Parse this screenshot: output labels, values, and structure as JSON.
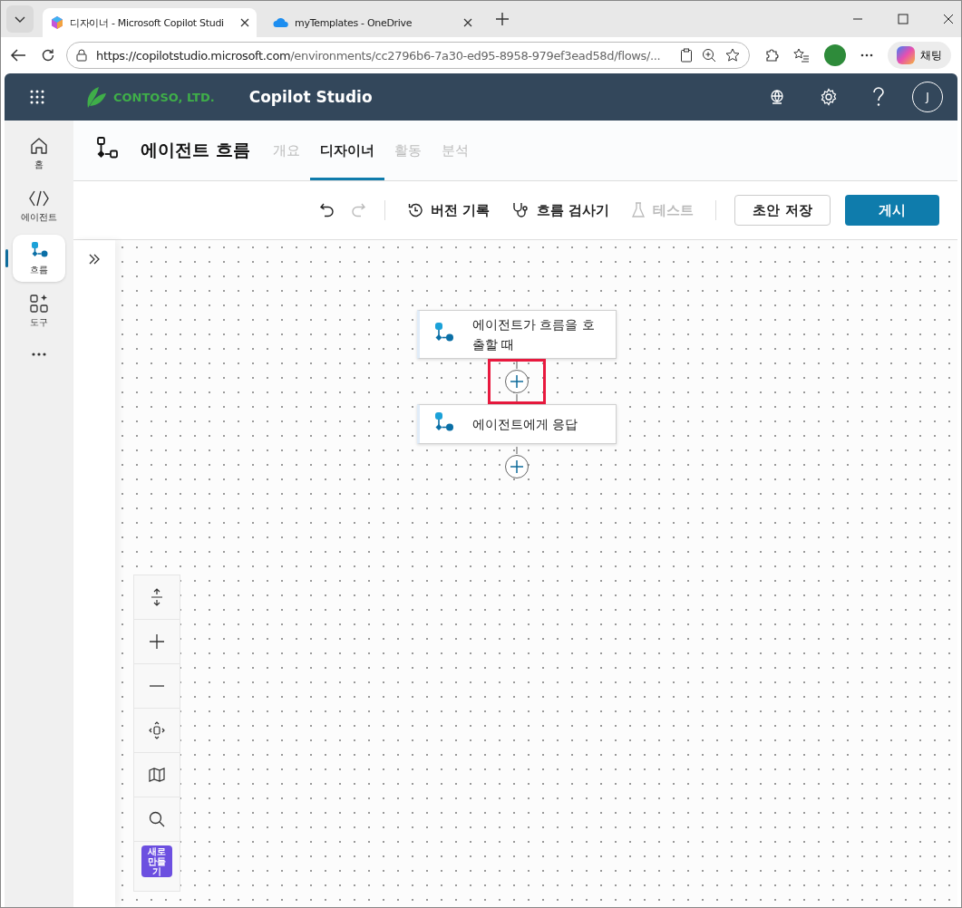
{
  "browser": {
    "tabs": [
      {
        "title": "디자이너 - Microsoft Copilot Studi",
        "selected": true
      },
      {
        "title": "myTemplates - OneDrive",
        "selected": false
      }
    ],
    "url_host": "https://copilotstudio.microsoft.com",
    "url_path": "/environments/cc2796b6-7a30-ed95-8958-979ef3ead58d/flows/...",
    "copilot_label": "채팅"
  },
  "app_header": {
    "brand": "CONTOSO, LTD.",
    "product": "Copilot Studio",
    "avatar": "J"
  },
  "nav": [
    {
      "label": "홈",
      "kind": "home",
      "selected": false
    },
    {
      "label": "에이전트",
      "kind": "agent",
      "selected": false
    },
    {
      "label": "흐름",
      "kind": "flow",
      "selected": true
    },
    {
      "label": "도구",
      "kind": "tools",
      "selected": false
    }
  ],
  "page": {
    "title": "에이전트 흐름",
    "tabs": [
      {
        "label": "개요",
        "selected": false,
        "disabled": true
      },
      {
        "label": "디자이너",
        "selected": true,
        "disabled": false
      },
      {
        "label": "활동",
        "selected": false,
        "disabled": true
      },
      {
        "label": "분석",
        "selected": false,
        "disabled": true
      }
    ]
  },
  "toolbar": {
    "undo_disabled": false,
    "redo_disabled": true,
    "actions": [
      {
        "label": "버전 기록",
        "kind": "history",
        "disabled": false
      },
      {
        "label": "흐름 검사기",
        "kind": "checker",
        "disabled": false
      },
      {
        "label": "테스트",
        "kind": "test",
        "disabled": true
      }
    ],
    "save_label": "초안 저장",
    "publish_label": "게시"
  },
  "canvas": {
    "nodes": [
      {
        "label": "에이전트가 흐름을 호출할 때",
        "add_highlighted": true
      },
      {
        "label": "에이전트에게 응답",
        "add_highlighted": false
      }
    ],
    "new_badge": "새로 만들기"
  }
}
